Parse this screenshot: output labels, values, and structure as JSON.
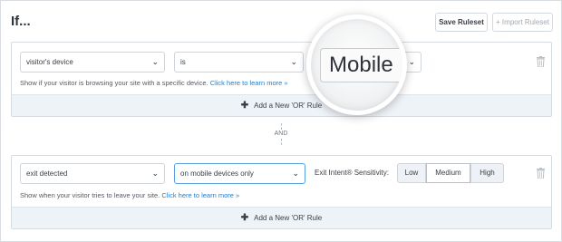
{
  "header": {
    "title": "If...",
    "save_label": "Save Ruleset",
    "import_label": "+ Import Ruleset"
  },
  "rule1": {
    "field": "visitor's device",
    "operator": "is",
    "value": "Mobile",
    "help_text": "Show if your visitor is browsing your site with a specific device.",
    "help_link": "Click here to learn more »",
    "add_or": "Add a New 'OR' Rule"
  },
  "connector": "AND",
  "rule2": {
    "field": "exit detected",
    "operator": "on mobile devices only",
    "sensitivity_label": "Exit Intent® Sensitivity:",
    "sensitivity_options": [
      "Low",
      "Medium",
      "High"
    ],
    "sensitivity_selected": "Medium",
    "help_text": "Show when your visitor tries to leave your site.",
    "help_link": "Click here to learn more »",
    "add_or": "Add a New 'OR' Rule"
  },
  "icons": {
    "chevron": "chevron-down-icon",
    "trash": "trash-icon",
    "plus": "plus-icon"
  },
  "colors": {
    "link": "#1e7fd2",
    "footer_bg": "#eef3f8",
    "active_border": "#5aa0e0"
  }
}
